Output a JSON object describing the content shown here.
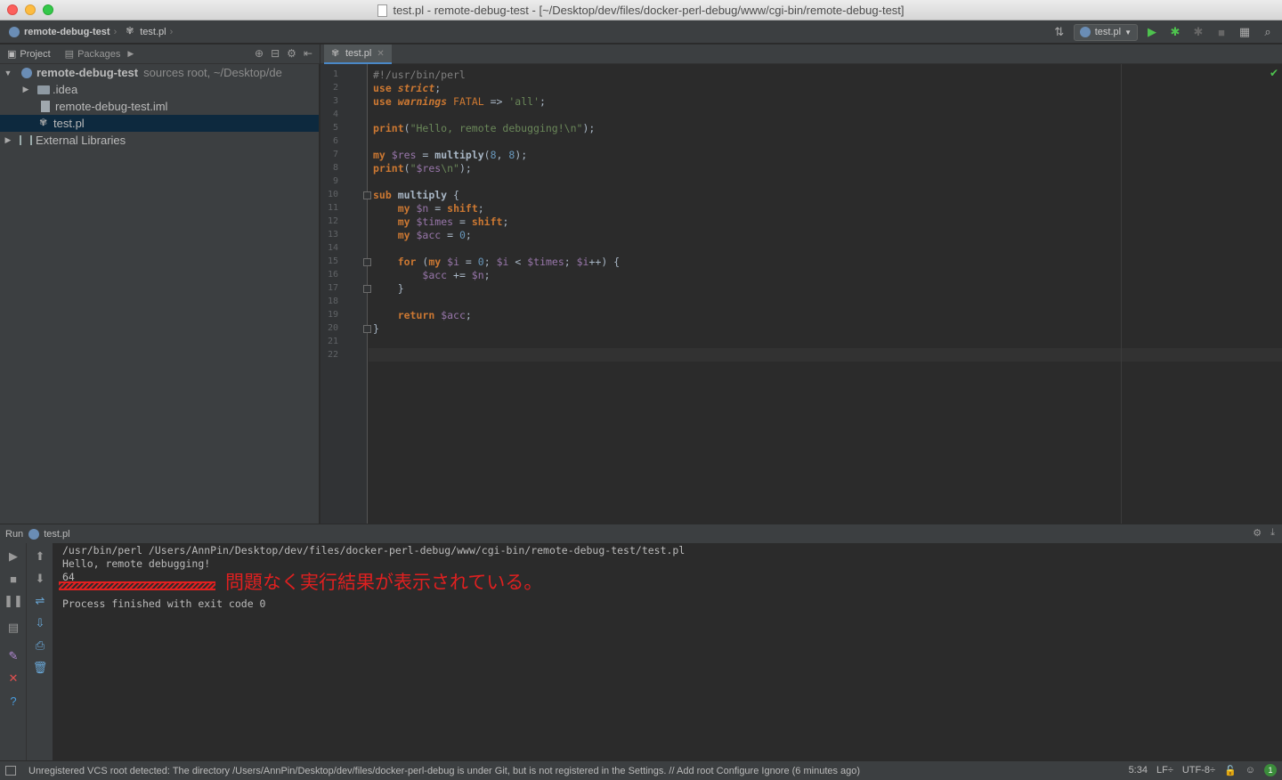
{
  "window": {
    "title": "test.pl - remote-debug-test - [~/Desktop/dev/files/docker-perl-debug/www/cgi-bin/remote-debug-test]"
  },
  "navbar": {
    "breadcrumb_project": "remote-debug-test",
    "breadcrumb_file": "test.pl",
    "run_config": "test.pl"
  },
  "project_panel": {
    "tabs": [
      {
        "label": "Project"
      },
      {
        "label": "Packages"
      }
    ],
    "root_name": "remote-debug-test",
    "root_detail": "sources root, ~/Desktop/de",
    "items": [
      {
        "label": ".idea"
      },
      {
        "label": "remote-debug-test.iml"
      },
      {
        "label": "test.pl"
      },
      {
        "label": "External Libraries"
      }
    ]
  },
  "editor": {
    "tab_label": "test.pl",
    "line_numbers": [
      "1",
      "2",
      "3",
      "4",
      "5",
      "6",
      "7",
      "8",
      "9",
      "10",
      "11",
      "12",
      "13",
      "14",
      "15",
      "16",
      "17",
      "18",
      "19",
      "20",
      "21",
      "22"
    ]
  },
  "run_panel": {
    "label": "Run",
    "tab_label": "test.pl",
    "output": [
      "/usr/bin/perl /Users/AnnPin/Desktop/dev/files/docker-perl-debug/www/cgi-bin/remote-debug-test/test.pl",
      "Hello, remote debugging!",
      "64",
      "Process finished with exit code 0"
    ],
    "annotation": "問題なく実行結果が表示されている。"
  },
  "statusbar": {
    "message": "Unregistered VCS root detected: The directory /Users/AnnPin/Desktop/dev/files/docker-perl-debug is under Git, but is not registered in the Settings. // Add root  Configure  Ignore (6 minutes ago)",
    "position": "5:34",
    "line_sep": "LF÷",
    "encoding": "UTF-8÷",
    "badge": "1"
  },
  "colors": {
    "background": "#2b2b2b",
    "panel": "#3c3f41",
    "keyword": "#cc7832",
    "string": "#6a8759",
    "variable": "#9876aa",
    "number": "#6897bb",
    "annotation": "#e02020"
  }
}
